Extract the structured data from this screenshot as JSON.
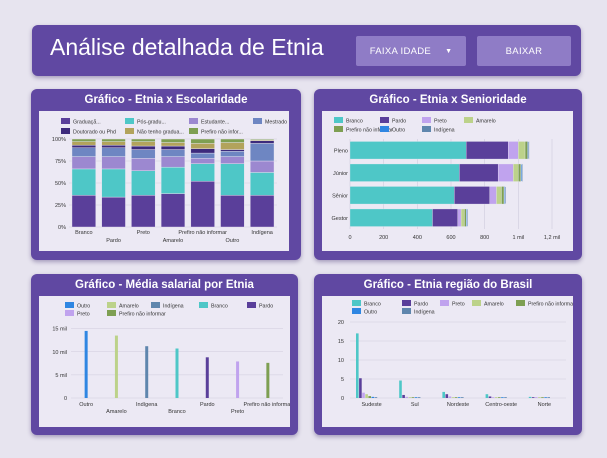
{
  "header": {
    "title": "Análise detalhada de Etnia",
    "filter_button": "FAIXA IDADE",
    "download_button": "BAIXAR"
  },
  "colors": {
    "Branco": "#4ec7c7",
    "Pardo": "#5a3f9a",
    "Preto": "#c0a3ee",
    "Amarelo": "#bcd28a",
    "Prefiro não informar": "#7e9f52",
    "Outro": "#2f86e2",
    "Indígena": "#5f86ad",
    "Graduação": "#5a3f9a",
    "Pós-graduação": "#4ec7c7",
    "Estudante": "#9c88d0",
    "Mestrado": "#6e86c2",
    "Doutorado ou Phd": "#3d2a7c",
    "Não tenho graduação formal": "#b2a35c",
    "Prefiro não informar (escolaridade)": "#7e9f52"
  },
  "panels": {
    "escolaridade_title": "Gráfico - Etnia x Escolaridade",
    "senioridade_title": "Gráfico - Etnia x Senioridade",
    "salario_title": "Gráfico - Média salarial por Etnia",
    "regiao_title": "Gráfico - Etnia região do Brasil"
  },
  "chart_data": [
    {
      "id": "escolaridade",
      "type": "bar",
      "stacked": "percent",
      "title": "Gráfico - Etnia x Escolaridade",
      "legend": [
        "Graduaçã...",
        "Pós-gradu...",
        "Estudante...",
        "Mestrado",
        "Doutorado ou Phd",
        "Não tenho gradua...",
        "Prefiro não infor..."
      ],
      "categories": [
        "Branco",
        "Pardo",
        "Preto",
        "Amarelo",
        "Prefiro não informar",
        "Outro",
        "Indígena"
      ],
      "yticks": [
        "0%",
        "25%",
        "50%",
        "75%",
        "100%"
      ],
      "ylim": [
        0,
        100
      ],
      "series": [
        {
          "name": "Graduação",
          "values": [
            36,
            34,
            36,
            38,
            52,
            36,
            36
          ]
        },
        {
          "name": "Pós-graduação",
          "values": [
            30,
            32,
            28,
            30,
            20,
            36,
            26
          ]
        },
        {
          "name": "Estudante",
          "values": [
            14,
            14,
            14,
            12,
            6,
            8,
            13
          ]
        },
        {
          "name": "Mestrado",
          "values": [
            10,
            10,
            10,
            8,
            6,
            6,
            20
          ]
        },
        {
          "name": "Doutorado ou Phd",
          "values": [
            3,
            3,
            4,
            4,
            5,
            2,
            3
          ]
        },
        {
          "name": "Não tenho graduação formal",
          "values": [
            4,
            4,
            5,
            4,
            6,
            8,
            1
          ]
        },
        {
          "name": "Prefiro não informar",
          "values": [
            3,
            3,
            3,
            4,
            5,
            4,
            1
          ]
        }
      ]
    },
    {
      "id": "senioridade",
      "type": "bar",
      "orientation": "horizontal",
      "stacked": true,
      "title": "Gráfico - Etnia x Senioridade",
      "legend": [
        "Branco",
        "Pardo",
        "Preto",
        "Amarelo",
        "Prefiro não informar",
        "Outro",
        "Indígena"
      ],
      "categories": [
        "Pleno",
        "Júnior",
        "Sênior",
        "Gestor"
      ],
      "xticks": [
        "0",
        "200",
        "400",
        "600",
        "800",
        "1 mil",
        "1,2 mil"
      ],
      "xlim": [
        0,
        1200
      ],
      "series": [
        {
          "name": "Branco",
          "values": [
            690,
            650,
            620,
            490
          ]
        },
        {
          "name": "Pardo",
          "values": [
            250,
            230,
            210,
            150
          ]
        },
        {
          "name": "Preto",
          "values": [
            60,
            90,
            40,
            20
          ]
        },
        {
          "name": "Amarelo",
          "values": [
            40,
            30,
            30,
            20
          ]
        },
        {
          "name": "Prefiro não informar",
          "values": [
            15,
            15,
            15,
            10
          ]
        },
        {
          "name": "Outro",
          "values": [
            5,
            5,
            5,
            5
          ]
        },
        {
          "name": "Indígena",
          "values": [
            5,
            5,
            5,
            5
          ]
        }
      ]
    },
    {
      "id": "salario",
      "type": "bar",
      "title": "Gráfico - Média salarial por Etnia",
      "legend": [
        "Outro",
        "Amarelo",
        "Indígena",
        "Branco",
        "Pardo",
        "Preto",
        "Prefiro não informar"
      ],
      "categories": [
        "Outro",
        "Amarelo",
        "Indígena",
        "Branco",
        "Pardo",
        "Preto",
        "Prefiro não informar"
      ],
      "values": [
        14500,
        13500,
        11200,
        10700,
        8800,
        7900,
        7600
      ],
      "yticks": [
        "0",
        "5 mil",
        "10 mil",
        "15 mil"
      ],
      "ylim": [
        0,
        16000
      ]
    },
    {
      "id": "regiao",
      "type": "bar",
      "title": "Gráfico - Etnia região do Brasil",
      "legend": [
        "Branco",
        "Pardo",
        "Preto",
        "Amarelo",
        "Prefiro não informar",
        "Outro",
        "Indígena"
      ],
      "categories": [
        "Sudeste",
        "Sul",
        "Nordeste",
        "Centro-oeste",
        "Norte"
      ],
      "yticks": [
        "0",
        "5",
        "10",
        "15",
        "20"
      ],
      "ylim": [
        0,
        20
      ],
      "series": [
        {
          "name": "Branco",
          "values": [
            17,
            4.6,
            1.6,
            1.0,
            0.3
          ]
        },
        {
          "name": "Pardo",
          "values": [
            5.2,
            0.8,
            1.0,
            0.4,
            0.2
          ]
        },
        {
          "name": "Preto",
          "values": [
            1.4,
            0.3,
            0.4,
            0.2,
            0.1
          ]
        },
        {
          "name": "Amarelo",
          "values": [
            1.0,
            0.2,
            0.2,
            0.1,
            0.05
          ]
        },
        {
          "name": "Prefiro não informar",
          "values": [
            0.5,
            0.1,
            0.1,
            0.1,
            0.05
          ]
        },
        {
          "name": "Outro",
          "values": [
            0.3,
            0.1,
            0.1,
            0.05,
            0.05
          ]
        },
        {
          "name": "Indígena",
          "values": [
            0.2,
            0.1,
            0.1,
            0.05,
            0.05
          ]
        }
      ]
    }
  ]
}
